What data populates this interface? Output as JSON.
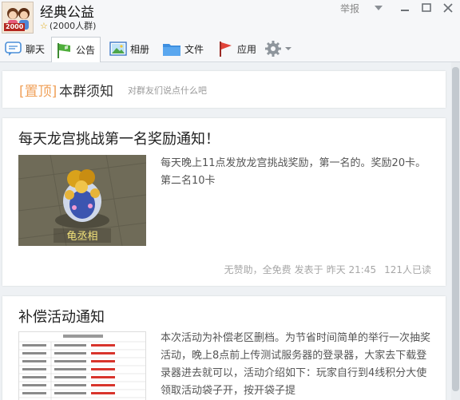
{
  "header": {
    "group_name": "经典公益",
    "member_count": "(2000人群)",
    "avatar_badge": "2000",
    "report_label": "举报"
  },
  "toolbar": {
    "items": [
      {
        "label": "聊天",
        "icon": "chat-bubble-icon"
      },
      {
        "label": "公告",
        "icon": "flag-icon"
      },
      {
        "label": "相册",
        "icon": "photo-icon"
      },
      {
        "label": "文件",
        "icon": "folder-icon"
      },
      {
        "label": "应用",
        "icon": "red-flag-icon"
      },
      {
        "label": "",
        "icon": "gear-icon"
      }
    ]
  },
  "rules": {
    "pin": "[置顶]",
    "title": "本群须知",
    "hint": "对群友们说点什么吧"
  },
  "notices": [
    {
      "title": "每天龙宫挑战第一名奖励通知！",
      "thumb_caption": "龟丞相",
      "body": "每天晚上11点发放龙宫挑战奖励，第一名的。奖励20卡。第二名10卡",
      "meta_status": "无赞助，全免费",
      "meta_posted": "发表于",
      "meta_time": "昨天 21:45",
      "meta_reads": "121人已读"
    },
    {
      "title": "补偿活动通知",
      "body": "本次活动为补偿老区删档。为节省时间简单的举行一次抽奖活动，晚上8点前上传测试服务器的登录器，大家去下载登录器进去就可以，活动介绍如下：玩家自行到4线积分大使领取活动袋子开，按开袋子提"
    }
  ],
  "colors": {
    "pin": "#f0a25b",
    "meta": "#a6a6a6",
    "toolbar_bg": "#f6f7f9",
    "content_bg": "#eef1f4"
  }
}
